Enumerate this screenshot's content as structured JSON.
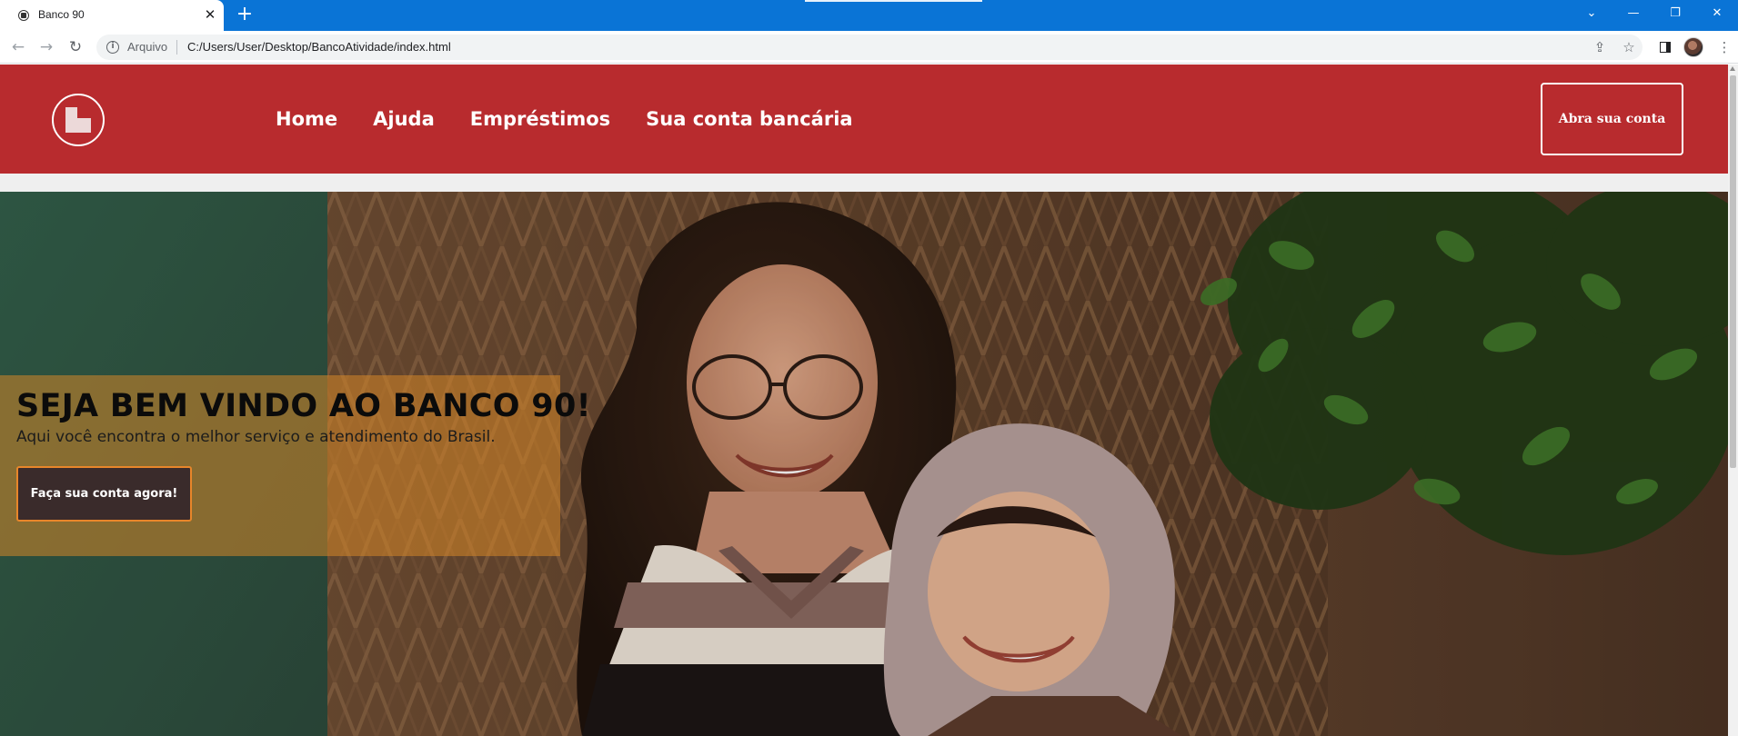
{
  "browser": {
    "tab": {
      "title": "Banco 90",
      "close_glyph": "✕"
    },
    "new_tab_glyph": "+",
    "window_controls": [
      "⌄",
      "—",
      "❐",
      "✕"
    ],
    "address": {
      "scheme_label": "Arquivo",
      "url": "C:/Users/User/Desktop/BancoAtividade/index.html"
    },
    "icons": [
      "back-icon",
      "forward-icon",
      "reload-icon",
      "info-icon",
      "share-icon",
      "star-icon",
      "sidepanel-icon",
      "profile-avatar",
      "menu-icon"
    ]
  },
  "header": {
    "nav": [
      "Home",
      "Ajuda",
      "Empréstimos",
      "Sua conta bancária"
    ],
    "cta": "Abra sua conta"
  },
  "hero": {
    "title": "SEJA BEM VINDO AO BANCO 90!",
    "subtitle": "Aqui você encontra o melhor serviço e atendimento do Brasil.",
    "cta": "Faça sua conta agora!"
  },
  "colors": {
    "tabstrip": "#0a74d6",
    "header": "#b82b2e",
    "welcome_overlay": "#d68628",
    "cta_border": "#e8862a",
    "cta_fill": "#3a2b2b"
  }
}
